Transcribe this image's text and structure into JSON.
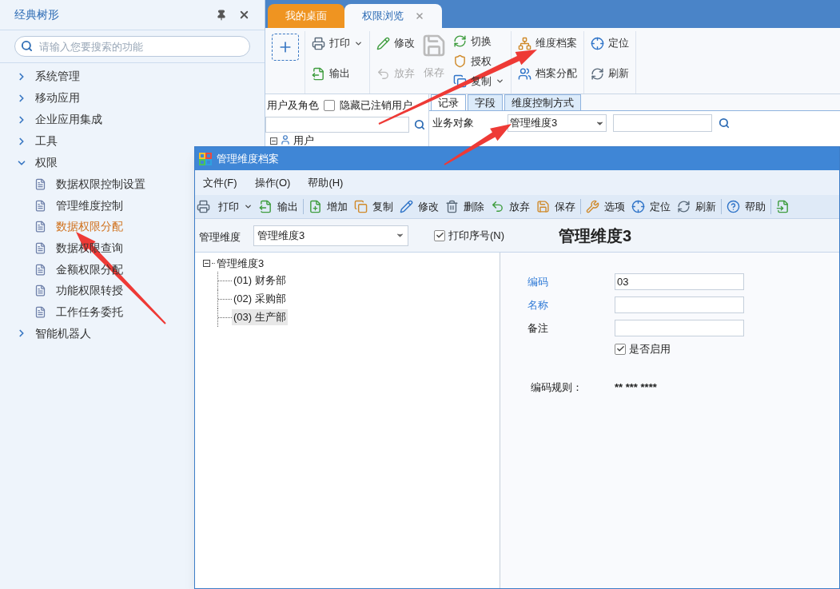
{
  "sidebar": {
    "title": "经典树形",
    "search": {
      "placeholder": "请输入您要搜索的功能"
    },
    "items": [
      {
        "label": "系统管理",
        "expanded": false
      },
      {
        "label": "移动应用",
        "expanded": false
      },
      {
        "label": "企业应用集成",
        "expanded": false
      },
      {
        "label": "工具",
        "expanded": false
      },
      {
        "label": "权限",
        "expanded": true,
        "children": [
          {
            "label": "数据权限控制设置",
            "selected": false
          },
          {
            "label": "管理维度控制",
            "selected": false
          },
          {
            "label": "数据权限分配",
            "selected": true
          },
          {
            "label": "数据权限查询",
            "selected": false
          },
          {
            "label": "金额权限分配",
            "selected": false
          },
          {
            "label": "功能权限转授",
            "selected": false
          },
          {
            "label": "工作任务委托",
            "selected": false
          }
        ]
      },
      {
        "label": "智能机器人",
        "expanded": false
      }
    ]
  },
  "tabs": [
    {
      "label": "我的桌面",
      "selected": false,
      "closable": false
    },
    {
      "label": "权限浏览",
      "selected": true,
      "closable": true
    }
  ],
  "ribbon": {
    "groups": [
      {
        "columns": [
          {
            "kind": "stack",
            "buttons": [
              {
                "label": "打印",
                "disabled": false,
                "dropdown": true
              },
              {
                "label": "输出",
                "disabled": false,
                "dropdown": false
              }
            ]
          }
        ]
      },
      {
        "columns": [
          {
            "kind": "stack",
            "buttons": [
              {
                "label": "修改",
                "disabled": false,
                "dropdown": false
              },
              {
                "label": "放弃",
                "disabled": true,
                "dropdown": false
              }
            ]
          },
          {
            "kind": "large",
            "buttons": [
              {
                "label": "保存",
                "disabled": true
              }
            ]
          },
          {
            "kind": "stack",
            "buttons": [
              {
                "label": "切换",
                "disabled": false,
                "dropdown": false
              },
              {
                "label": "授权",
                "disabled": false,
                "dropdown": false
              },
              {
                "label": "复制",
                "disabled": false,
                "dropdown": true
              }
            ]
          }
        ]
      },
      {
        "columns": [
          {
            "kind": "stack",
            "buttons": [
              {
                "label": "维度档案",
                "disabled": false,
                "dropdown": false
              },
              {
                "label": "档案分配",
                "disabled": false,
                "dropdown": false
              }
            ]
          }
        ]
      },
      {
        "columns": [
          {
            "kind": "stack",
            "buttons": [
              {
                "label": "定位",
                "disabled": false,
                "dropdown": false
              },
              {
                "label": "刷新",
                "disabled": false,
                "dropdown": false
              }
            ]
          }
        ]
      }
    ]
  },
  "users_panel": {
    "label": "用户及角色",
    "hide_checkbox": {
      "label": "隐藏已注销用户",
      "checked": false
    },
    "tree": [
      {
        "label": "用户",
        "expanded": true
      }
    ]
  },
  "record_panel": {
    "tabs": [
      {
        "label": "记录",
        "selected": true
      },
      {
        "label": "字段",
        "selected": false
      },
      {
        "label": "维度控制方式",
        "selected": false
      }
    ],
    "object_label": "业务对象",
    "object_value": "管理维度3"
  },
  "dialog": {
    "title": "管理维度档案",
    "menu": [
      "文件(F)",
      "操作(O)",
      "帮助(H)"
    ],
    "toolbar": [
      [
        {
          "label": "打印",
          "dropdown": true
        },
        {
          "label": "输出",
          "dropdown": false
        }
      ],
      [
        {
          "label": "增加",
          "dropdown": false
        },
        {
          "label": "复制",
          "dropdown": false
        },
        {
          "label": "修改",
          "dropdown": false
        },
        {
          "label": "删除",
          "dropdown": false
        },
        {
          "label": "放弃",
          "dropdown": false
        },
        {
          "label": "保存",
          "dropdown": false
        }
      ],
      [
        {
          "label": "选项",
          "dropdown": false
        },
        {
          "label": "定位",
          "dropdown": false
        },
        {
          "label": "刷新",
          "dropdown": false
        }
      ],
      [
        {
          "label": "帮助",
          "dropdown": false
        }
      ]
    ],
    "filter": {
      "label": "管理维度",
      "value": "管理维度3",
      "print_checkbox": {
        "label": "打印序号(N)",
        "checked": true
      },
      "heading": "管理维度3"
    },
    "tree": {
      "label": "管理维度3",
      "expanded": true,
      "children": [
        {
          "label": "(01) 财务部",
          "selected": false
        },
        {
          "label": "(02) 采购部",
          "selected": false
        },
        {
          "label": "(03) 生产部",
          "selected": true
        }
      ]
    },
    "form": {
      "fields": [
        {
          "label": "编码",
          "value": "03",
          "required": true
        },
        {
          "label": "名称",
          "required": true
        },
        {
          "label": "备注",
          "required": false
        }
      ],
      "enabled_checkbox": {
        "label": "是否启用",
        "checked": true
      },
      "rule": {
        "label": "编码规则：",
        "value": "** *** ****"
      }
    }
  }
}
